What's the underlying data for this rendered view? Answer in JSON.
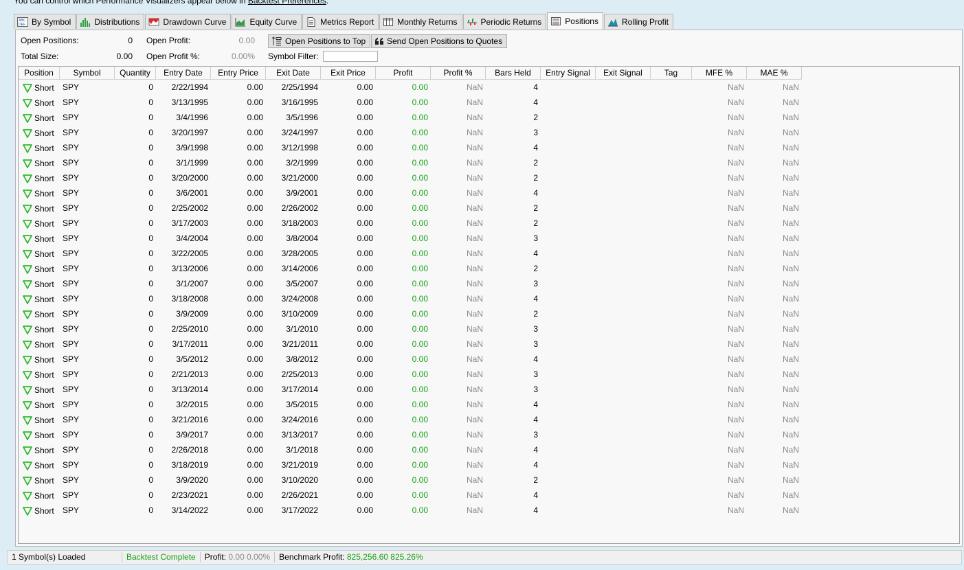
{
  "top_note": {
    "text": "You can control which Performance Visualizers appear below in ",
    "link": "Backtest Preferences",
    "end": "."
  },
  "tabs": [
    {
      "label": "By Symbol",
      "icon": "abc-def-icon",
      "active": false
    },
    {
      "label": "Distributions",
      "icon": "histogram-icon",
      "active": false
    },
    {
      "label": "Drawdown Curve",
      "icon": "drawdown-icon",
      "active": false
    },
    {
      "label": "Equity Curve",
      "icon": "area-chart-icon",
      "active": false
    },
    {
      "label": "Metrics Report",
      "icon": "document-icon",
      "active": false
    },
    {
      "label": "Monthly Returns",
      "icon": "columns-icon",
      "active": false
    },
    {
      "label": "Periodic Returns",
      "icon": "bar-chart-icon",
      "active": false
    },
    {
      "label": "Positions",
      "icon": "list-icon",
      "active": true
    },
    {
      "label": "Rolling Profit",
      "icon": "mountain-icon",
      "active": false
    }
  ],
  "summary": {
    "open_positions_label": "Open Positions:",
    "open_positions_value": "0",
    "total_size_label": "Total Size:",
    "total_size_value": "0.00",
    "open_profit_label": "Open Profit:",
    "open_profit_value": "0.00",
    "open_profit_pct_label": "Open Profit %:",
    "open_profit_pct_value": "0.00%",
    "symbol_filter_label": "Symbol Filter:",
    "symbol_filter_value": ""
  },
  "buttons": {
    "open_to_top": "Open Positions to Top",
    "send_to_quotes": "Send Open Positions to Quotes"
  },
  "columns": [
    "Position",
    "Symbol",
    "Quantity",
    "Entry Date",
    "Entry Price",
    "Exit Date",
    "Exit Price",
    "Profit",
    "Profit %",
    "Bars Held",
    "Entry Signal",
    "Exit Signal",
    "Tag",
    "MFE %",
    "MAE %"
  ],
  "rows": [
    [
      "Short",
      "SPY",
      "0",
      "2/22/1994",
      "0.00",
      "2/25/1994",
      "0.00",
      "0.00",
      "NaN",
      "4",
      "",
      "",
      "",
      "NaN",
      "NaN"
    ],
    [
      "Short",
      "SPY",
      "0",
      "3/13/1995",
      "0.00",
      "3/16/1995",
      "0.00",
      "0.00",
      "NaN",
      "4",
      "",
      "",
      "",
      "NaN",
      "NaN"
    ],
    [
      "Short",
      "SPY",
      "0",
      "3/4/1996",
      "0.00",
      "3/5/1996",
      "0.00",
      "0.00",
      "NaN",
      "2",
      "",
      "",
      "",
      "NaN",
      "NaN"
    ],
    [
      "Short",
      "SPY",
      "0",
      "3/20/1997",
      "0.00",
      "3/24/1997",
      "0.00",
      "0.00",
      "NaN",
      "3",
      "",
      "",
      "",
      "NaN",
      "NaN"
    ],
    [
      "Short",
      "SPY",
      "0",
      "3/9/1998",
      "0.00",
      "3/12/1998",
      "0.00",
      "0.00",
      "NaN",
      "4",
      "",
      "",
      "",
      "NaN",
      "NaN"
    ],
    [
      "Short",
      "SPY",
      "0",
      "3/1/1999",
      "0.00",
      "3/2/1999",
      "0.00",
      "0.00",
      "NaN",
      "2",
      "",
      "",
      "",
      "NaN",
      "NaN"
    ],
    [
      "Short",
      "SPY",
      "0",
      "3/20/2000",
      "0.00",
      "3/21/2000",
      "0.00",
      "0.00",
      "NaN",
      "2",
      "",
      "",
      "",
      "NaN",
      "NaN"
    ],
    [
      "Short",
      "SPY",
      "0",
      "3/6/2001",
      "0.00",
      "3/9/2001",
      "0.00",
      "0.00",
      "NaN",
      "4",
      "",
      "",
      "",
      "NaN",
      "NaN"
    ],
    [
      "Short",
      "SPY",
      "0",
      "2/25/2002",
      "0.00",
      "2/26/2002",
      "0.00",
      "0.00",
      "NaN",
      "2",
      "",
      "",
      "",
      "NaN",
      "NaN"
    ],
    [
      "Short",
      "SPY",
      "0",
      "3/17/2003",
      "0.00",
      "3/18/2003",
      "0.00",
      "0.00",
      "NaN",
      "2",
      "",
      "",
      "",
      "NaN",
      "NaN"
    ],
    [
      "Short",
      "SPY",
      "0",
      "3/4/2004",
      "0.00",
      "3/8/2004",
      "0.00",
      "0.00",
      "NaN",
      "3",
      "",
      "",
      "",
      "NaN",
      "NaN"
    ],
    [
      "Short",
      "SPY",
      "0",
      "3/22/2005",
      "0.00",
      "3/28/2005",
      "0.00",
      "0.00",
      "NaN",
      "4",
      "",
      "",
      "",
      "NaN",
      "NaN"
    ],
    [
      "Short",
      "SPY",
      "0",
      "3/13/2006",
      "0.00",
      "3/14/2006",
      "0.00",
      "0.00",
      "NaN",
      "2",
      "",
      "",
      "",
      "NaN",
      "NaN"
    ],
    [
      "Short",
      "SPY",
      "0",
      "3/1/2007",
      "0.00",
      "3/5/2007",
      "0.00",
      "0.00",
      "NaN",
      "3",
      "",
      "",
      "",
      "NaN",
      "NaN"
    ],
    [
      "Short",
      "SPY",
      "0",
      "3/18/2008",
      "0.00",
      "3/24/2008",
      "0.00",
      "0.00",
      "NaN",
      "4",
      "",
      "",
      "",
      "NaN",
      "NaN"
    ],
    [
      "Short",
      "SPY",
      "0",
      "3/9/2009",
      "0.00",
      "3/10/2009",
      "0.00",
      "0.00",
      "NaN",
      "2",
      "",
      "",
      "",
      "NaN",
      "NaN"
    ],
    [
      "Short",
      "SPY",
      "0",
      "2/25/2010",
      "0.00",
      "3/1/2010",
      "0.00",
      "0.00",
      "NaN",
      "3",
      "",
      "",
      "",
      "NaN",
      "NaN"
    ],
    [
      "Short",
      "SPY",
      "0",
      "3/17/2011",
      "0.00",
      "3/21/2011",
      "0.00",
      "0.00",
      "NaN",
      "3",
      "",
      "",
      "",
      "NaN",
      "NaN"
    ],
    [
      "Short",
      "SPY",
      "0",
      "3/5/2012",
      "0.00",
      "3/8/2012",
      "0.00",
      "0.00",
      "NaN",
      "4",
      "",
      "",
      "",
      "NaN",
      "NaN"
    ],
    [
      "Short",
      "SPY",
      "0",
      "2/21/2013",
      "0.00",
      "2/25/2013",
      "0.00",
      "0.00",
      "NaN",
      "3",
      "",
      "",
      "",
      "NaN",
      "NaN"
    ],
    [
      "Short",
      "SPY",
      "0",
      "3/13/2014",
      "0.00",
      "3/17/2014",
      "0.00",
      "0.00",
      "NaN",
      "3",
      "",
      "",
      "",
      "NaN",
      "NaN"
    ],
    [
      "Short",
      "SPY",
      "0",
      "3/2/2015",
      "0.00",
      "3/5/2015",
      "0.00",
      "0.00",
      "NaN",
      "4",
      "",
      "",
      "",
      "NaN",
      "NaN"
    ],
    [
      "Short",
      "SPY",
      "0",
      "3/21/2016",
      "0.00",
      "3/24/2016",
      "0.00",
      "0.00",
      "NaN",
      "4",
      "",
      "",
      "",
      "NaN",
      "NaN"
    ],
    [
      "Short",
      "SPY",
      "0",
      "3/9/2017",
      "0.00",
      "3/13/2017",
      "0.00",
      "0.00",
      "NaN",
      "3",
      "",
      "",
      "",
      "NaN",
      "NaN"
    ],
    [
      "Short",
      "SPY",
      "0",
      "2/26/2018",
      "0.00",
      "3/1/2018",
      "0.00",
      "0.00",
      "NaN",
      "4",
      "",
      "",
      "",
      "NaN",
      "NaN"
    ],
    [
      "Short",
      "SPY",
      "0",
      "3/18/2019",
      "0.00",
      "3/21/2019",
      "0.00",
      "0.00",
      "NaN",
      "4",
      "",
      "",
      "",
      "NaN",
      "NaN"
    ],
    [
      "Short",
      "SPY",
      "0",
      "3/9/2020",
      "0.00",
      "3/10/2020",
      "0.00",
      "0.00",
      "NaN",
      "2",
      "",
      "",
      "",
      "NaN",
      "NaN"
    ],
    [
      "Short",
      "SPY",
      "0",
      "2/23/2021",
      "0.00",
      "2/26/2021",
      "0.00",
      "0.00",
      "NaN",
      "4",
      "",
      "",
      "",
      "NaN",
      "NaN"
    ],
    [
      "Short",
      "SPY",
      "0",
      "3/14/2022",
      "0.00",
      "3/17/2022",
      "0.00",
      "0.00",
      "NaN",
      "4",
      "",
      "",
      "",
      "NaN",
      "NaN"
    ]
  ],
  "status": {
    "symbols_loaded": "1 Symbol(s) Loaded",
    "backtest": "Backtest Complete",
    "profit_label": "Profit:",
    "profit_value": "0.00",
    "profit_pct": "0.00%",
    "benchmark_label": "Benchmark Profit:",
    "benchmark_value": "825,256.60",
    "benchmark_pct": "825.26%"
  },
  "colors": {
    "profit_green": "#18a018",
    "short_triangle": "#2eb82e",
    "muted": "#8a8a8a"
  }
}
